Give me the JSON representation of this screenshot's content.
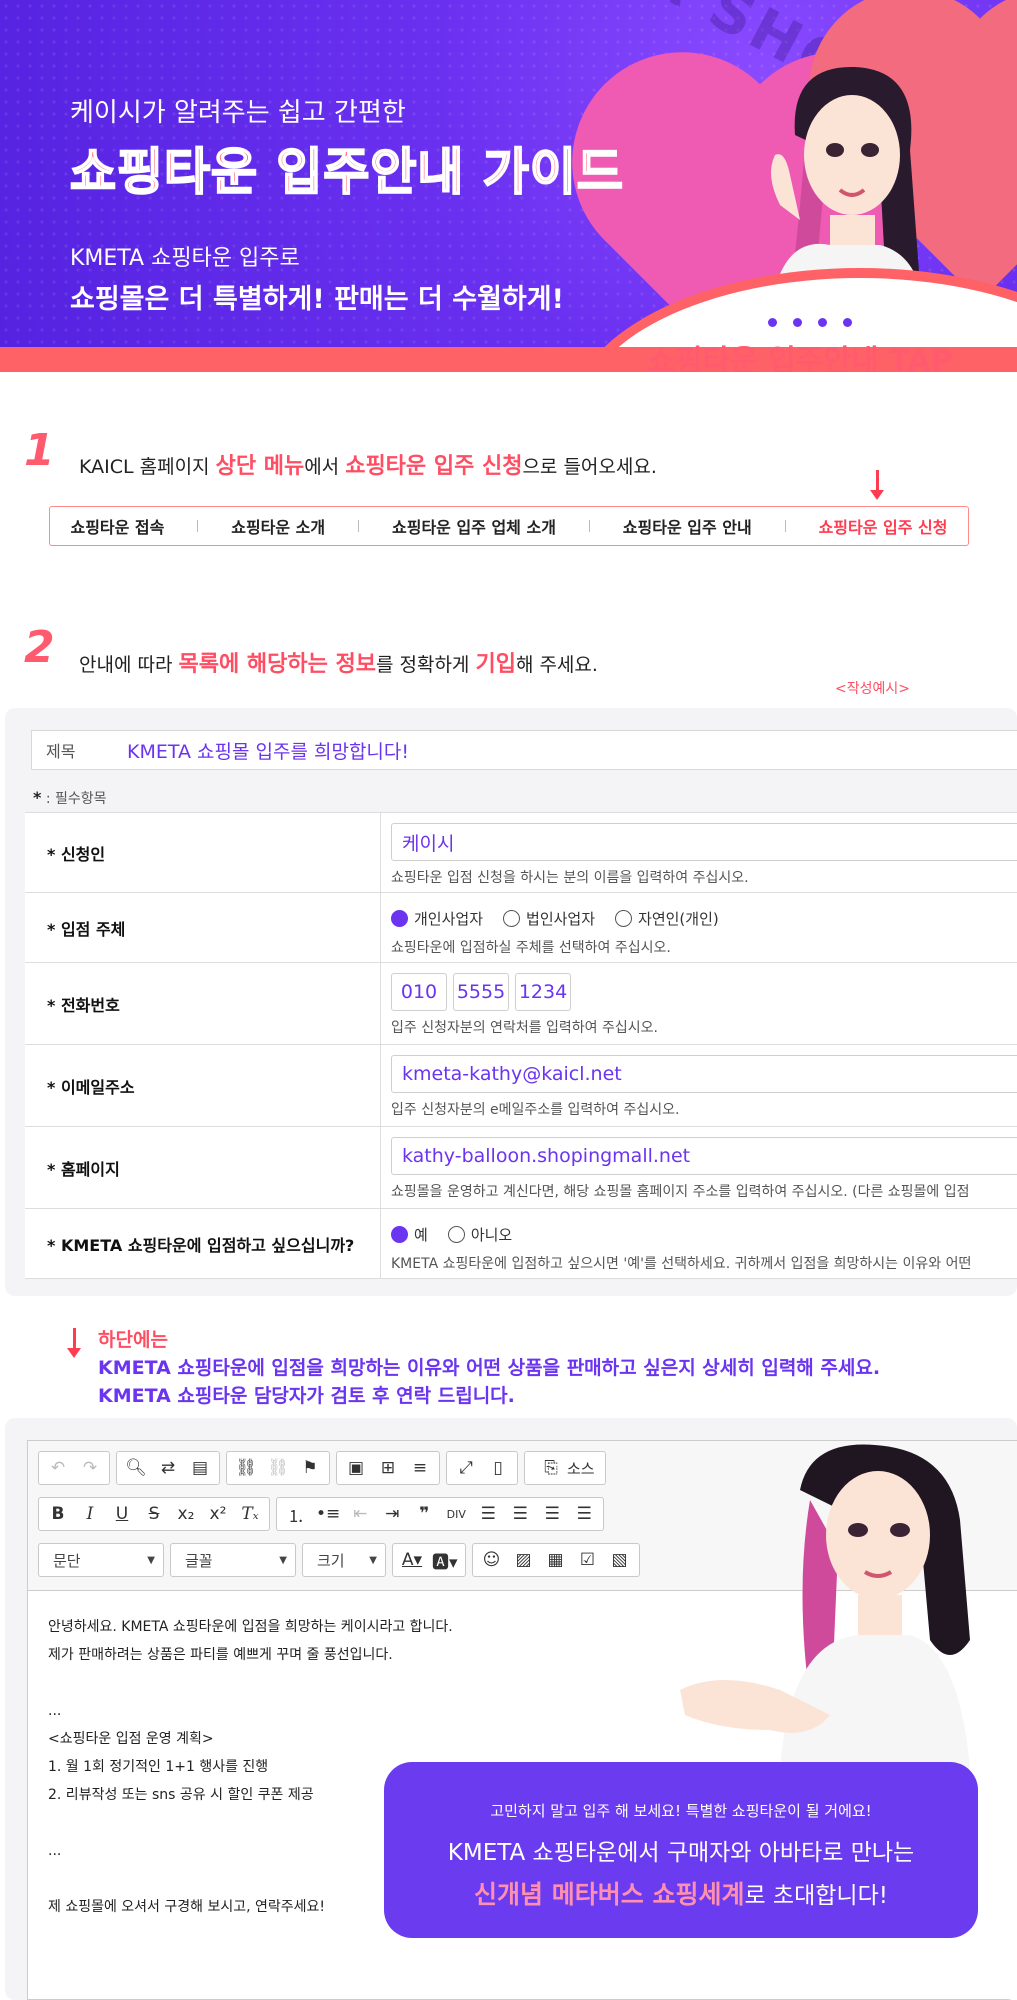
{
  "hero": {
    "subtitle": "케이시가 알려주는 쉽고 간편한",
    "title": "쇼핑타운 입주안내 가이드",
    "line1": "KMETA 쇼핑타운 입주로",
    "line2": "쇼핑몰은 더 특별하게! 판매는 더 수월하게!",
    "watermark": "KMETA SHOPING TOWN",
    "tap_label": "쇼핑타운 입주안내 TAP"
  },
  "step1": {
    "number": "1",
    "text_a": "KAICL 홈페이지 ",
    "hl_a": "상단 메뉴",
    "text_b": "에서 ",
    "hl_b": "쇼핑타운 입주 신청",
    "text_c": "으로 들어오세요."
  },
  "menu": {
    "items": [
      "쇼핑타운 접속",
      "쇼핑타운 소개",
      "쇼핑타운 입주 업체 소개",
      "쇼핑타운 입주 안내",
      "쇼핑타운 입주 신청"
    ]
  },
  "step2": {
    "number": "2",
    "text_a": "안내에 따라 ",
    "hl_a": "목록에 해당하는 정보",
    "text_b": "를 정확하게 ",
    "hl_b": "기입",
    "text_c": "해 주세요.",
    "example_tag": "<작성예시>"
  },
  "form": {
    "subject_label": "제목",
    "subject_value": "KMETA 쇼핑몰 입주를 희망합니다!",
    "required_star": "*",
    "required_text": " : 필수항목",
    "rows": {
      "applicant": {
        "label": "* 신청인",
        "value": "케이시",
        "help": "쇼핑타운 입점 신청을 하시는 분의 이름을 입력하여 주십시오."
      },
      "entity": {
        "label": "* 입점 주체",
        "options": [
          "개인사업자",
          "법인사업자",
          "자연인(개인)"
        ],
        "help": "쇼핑타운에 입점하실 주체를 선택하여 주십시오."
      },
      "phone": {
        "label": "* 전화번호",
        "parts": [
          "010",
          "5555",
          "1234"
        ],
        "help": "입주 신청자분의 연락처를 입력하여 주십시오."
      },
      "email": {
        "label": "* 이메일주소",
        "value": "kmeta-kathy@kaicl.net",
        "help": "입주 신청자분의 e메일주소를 입력하여 주십시오."
      },
      "homepage": {
        "label": "* 홈페이지",
        "value": "kathy-balloon.shopingmall.net",
        "help": "쇼핑몰을 운영하고 계신다면, 해당 쇼핑몰 홈페이지 주소를 입력하여 주십시오. (다른 쇼핑몰에 입점"
      },
      "join": {
        "label": "* KMETA 쇼핑타운에 입점하고 싶으십니까?",
        "options": [
          "예",
          "아니오"
        ],
        "help": "KMETA 쇼핑타운에 입점하고 싶으시면 '예'를 선택하세요. 귀하께서 입점을 희망하시는 이유와 어떤"
      }
    }
  },
  "note": {
    "title": "하단에는",
    "line1": "KMETA 쇼핑타운에 입점을 희망하는 이유와 어떤 상품을 판매하고 싶은지 상세히 입력해 주세요.",
    "line2": "KMETA 쇼핑타운 담당자가 검토 후 연락 드립니다."
  },
  "editor": {
    "source_label": "소스",
    "paragraph_select": "문단",
    "font_select": "글꼴",
    "size_select": "크기",
    "body": [
      "안녕하세요. KMETA 쇼핑타운에 입점을 희망하는 케이시라고 합니다.",
      "제가 판매하려는 상품은 파티를 예쁘게 꾸며 줄 풍선입니다.",
      "",
      "...",
      "<쇼핑타운 입점 운영 계획>",
      "1. 월 1회 정기적인 1+1 행사를 진행",
      "2. 리뷰작성 또는 sns 공유 시 할인 쿠폰 제공",
      "",
      "...",
      "",
      "제 쇼핑몰에 오셔서 구경해 보시고, 연락주세요!"
    ]
  },
  "cta": {
    "small": "고민하지 말고 입주 해 보세요! 특별한 쇼핑타운이 될 거에요!",
    "line1": "KMETA 쇼핑타운에서 구매자와 아바타로 만나는",
    "line2_hl": "신개념 메타버스 쇼핑세계",
    "line2_rest": "로 초대합니다!"
  },
  "colors": {
    "accent_purple": "#6b34f0",
    "accent_red": "#ff4e63"
  }
}
